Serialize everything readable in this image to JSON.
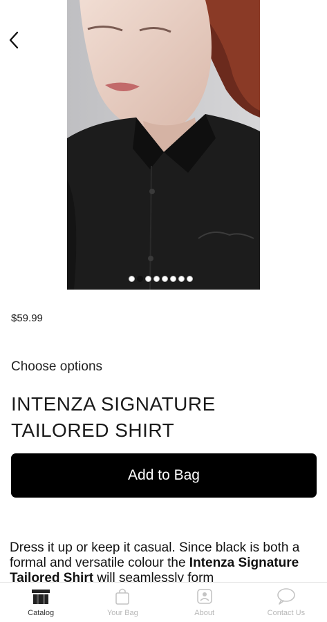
{
  "product": {
    "price": "$59.99",
    "options_label": "Choose options",
    "title_line1": "INTENZA SIGNATURE",
    "title_line2": "TAILORED SHIRT",
    "add_to_bag_label": "Add to Bag",
    "description_text_1": "Dress it up or keep it casual.  Since black is both a formal and versatile colour the ",
    "description_bold": "Intenza Signature Tailored Shirt",
    "description_text_2": " will seamlessly form"
  },
  "carousel": {
    "slide_count": 8,
    "active_index": 1
  },
  "tabbar": {
    "items": [
      {
        "label": "Catalog",
        "icon": "catalog-icon",
        "active": true
      },
      {
        "label": "Your Bag",
        "icon": "bag-icon",
        "active": false
      },
      {
        "label": "About",
        "icon": "about-icon",
        "active": false
      },
      {
        "label": "Contact Us",
        "icon": "chat-icon",
        "active": false
      }
    ]
  },
  "colors": {
    "primary_button": "#000000",
    "active_tab": "#333333",
    "inactive_tab": "#b7b7b7"
  }
}
